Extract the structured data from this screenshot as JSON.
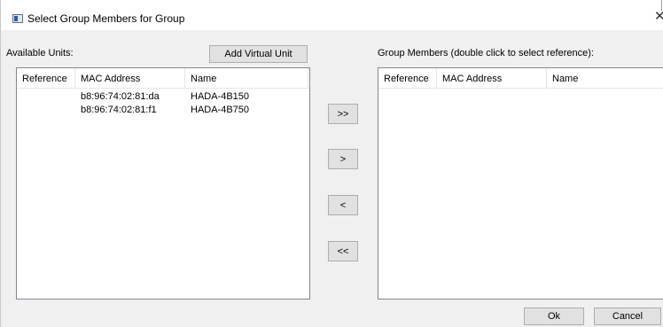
{
  "window": {
    "title": "Select Group Members for Group",
    "close_symbol": "✕"
  },
  "available": {
    "label": "Available Units:",
    "add_virtual_label": "Add Virtual Unit",
    "columns": [
      "Reference",
      "MAC Address",
      "Name"
    ],
    "rows": [
      {
        "reference": "",
        "mac": "b8:96:74:02:81:da",
        "name": "HADA-4B150"
      },
      {
        "reference": "",
        "mac": "b8:96:74:02:81:f1",
        "name": "HADA-4B750"
      }
    ]
  },
  "transfer": {
    "add_all": ">>",
    "add": ">",
    "remove": "<",
    "remove_all": "<<"
  },
  "members": {
    "label": "Group Members (double click to select reference):",
    "columns": [
      "Reference",
      "MAC Address",
      "Name"
    ],
    "rows": []
  },
  "footer": {
    "ok_label": "Ok",
    "cancel_label": "Cancel"
  },
  "icons": [
    "window-app-icon",
    "close-icon"
  ]
}
